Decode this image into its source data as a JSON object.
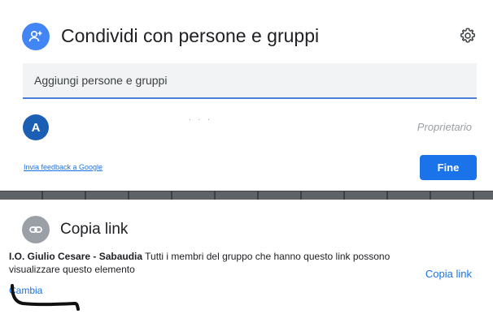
{
  "share": {
    "title": "Condividi con persone e gruppi",
    "icon": "person-add-icon",
    "accent": "#4285f4",
    "input_placeholder": "Aggiungi persone e gruppi",
    "owner": {
      "avatar_letter": "A",
      "avatar_color": "#1a5fb4",
      "faint_text": ". . .",
      "role": "Proprietario"
    },
    "feedback_link": "Invia feedback a Google",
    "done_label": "Fine",
    "primary_color": "#1a73e8"
  },
  "link": {
    "title": "Copia link",
    "icon": "link-icon",
    "org": "I.O. Giulio Cesare - Sabaudia",
    "description": "Tutti i membri del gruppo che hanno questo link possono visualizzare questo elemento",
    "change_label": "Cambia",
    "copy_label": "Copia link"
  }
}
